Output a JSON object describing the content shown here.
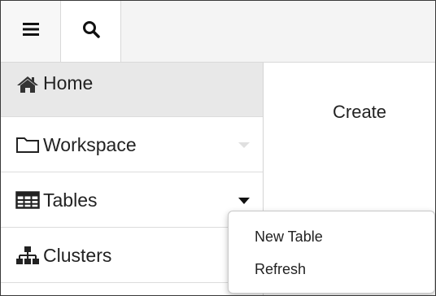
{
  "toolbar": {
    "menu_icon": "hamburger-icon",
    "search_icon": "search-icon"
  },
  "sidebar": {
    "items": [
      {
        "label": "Home",
        "icon": "home-icon",
        "active": true
      },
      {
        "label": "Workspace",
        "icon": "folder-icon",
        "caret": "chevron-down-icon"
      },
      {
        "label": "Tables",
        "icon": "table-icon",
        "caret": "chevron-down-icon"
      },
      {
        "label": "Clusters",
        "icon": "clusters-icon"
      }
    ]
  },
  "main": {
    "create_label": "Create"
  },
  "dropdown": {
    "items": [
      {
        "label": "New Table"
      },
      {
        "label": "Refresh"
      }
    ]
  },
  "colors": {
    "active_item_bg": "#e8e8e8",
    "topbar_bg": "#f4f4f4",
    "text": "#222222"
  }
}
